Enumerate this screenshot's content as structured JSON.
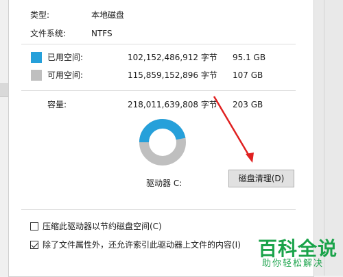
{
  "properties": {
    "type_label": "类型:",
    "type_value": "本地磁盘",
    "fs_label": "文件系统:",
    "fs_value": "NTFS"
  },
  "space": {
    "used": {
      "label": "已用空间:",
      "bytes": "102,152,486,912 字节",
      "size": "95.1 GB",
      "color": "#26a0da"
    },
    "free": {
      "label": "可用空间:",
      "bytes": "115,859,152,896 字节",
      "size": "107 GB",
      "color": "#bfbfbf"
    },
    "capacity": {
      "label": "容量:",
      "bytes": "218,011,639,808 字节",
      "size": "203 GB"
    },
    "used_fraction": 0.469
  },
  "drive": {
    "label": "驱动器 C:"
  },
  "cleanup_button": "磁盘清理(D)",
  "options": {
    "compress_label": "压缩此驱动器以节约磁盘空间(C)",
    "compress_checked": false,
    "index_label": "除了文件属性外，还允许索引此驱动器上文件的内容(I)",
    "index_checked": true
  },
  "watermark": {
    "title": "百科全说",
    "subtitle": "助你轻松解决"
  },
  "colors": {
    "arrow": "#e02020"
  }
}
